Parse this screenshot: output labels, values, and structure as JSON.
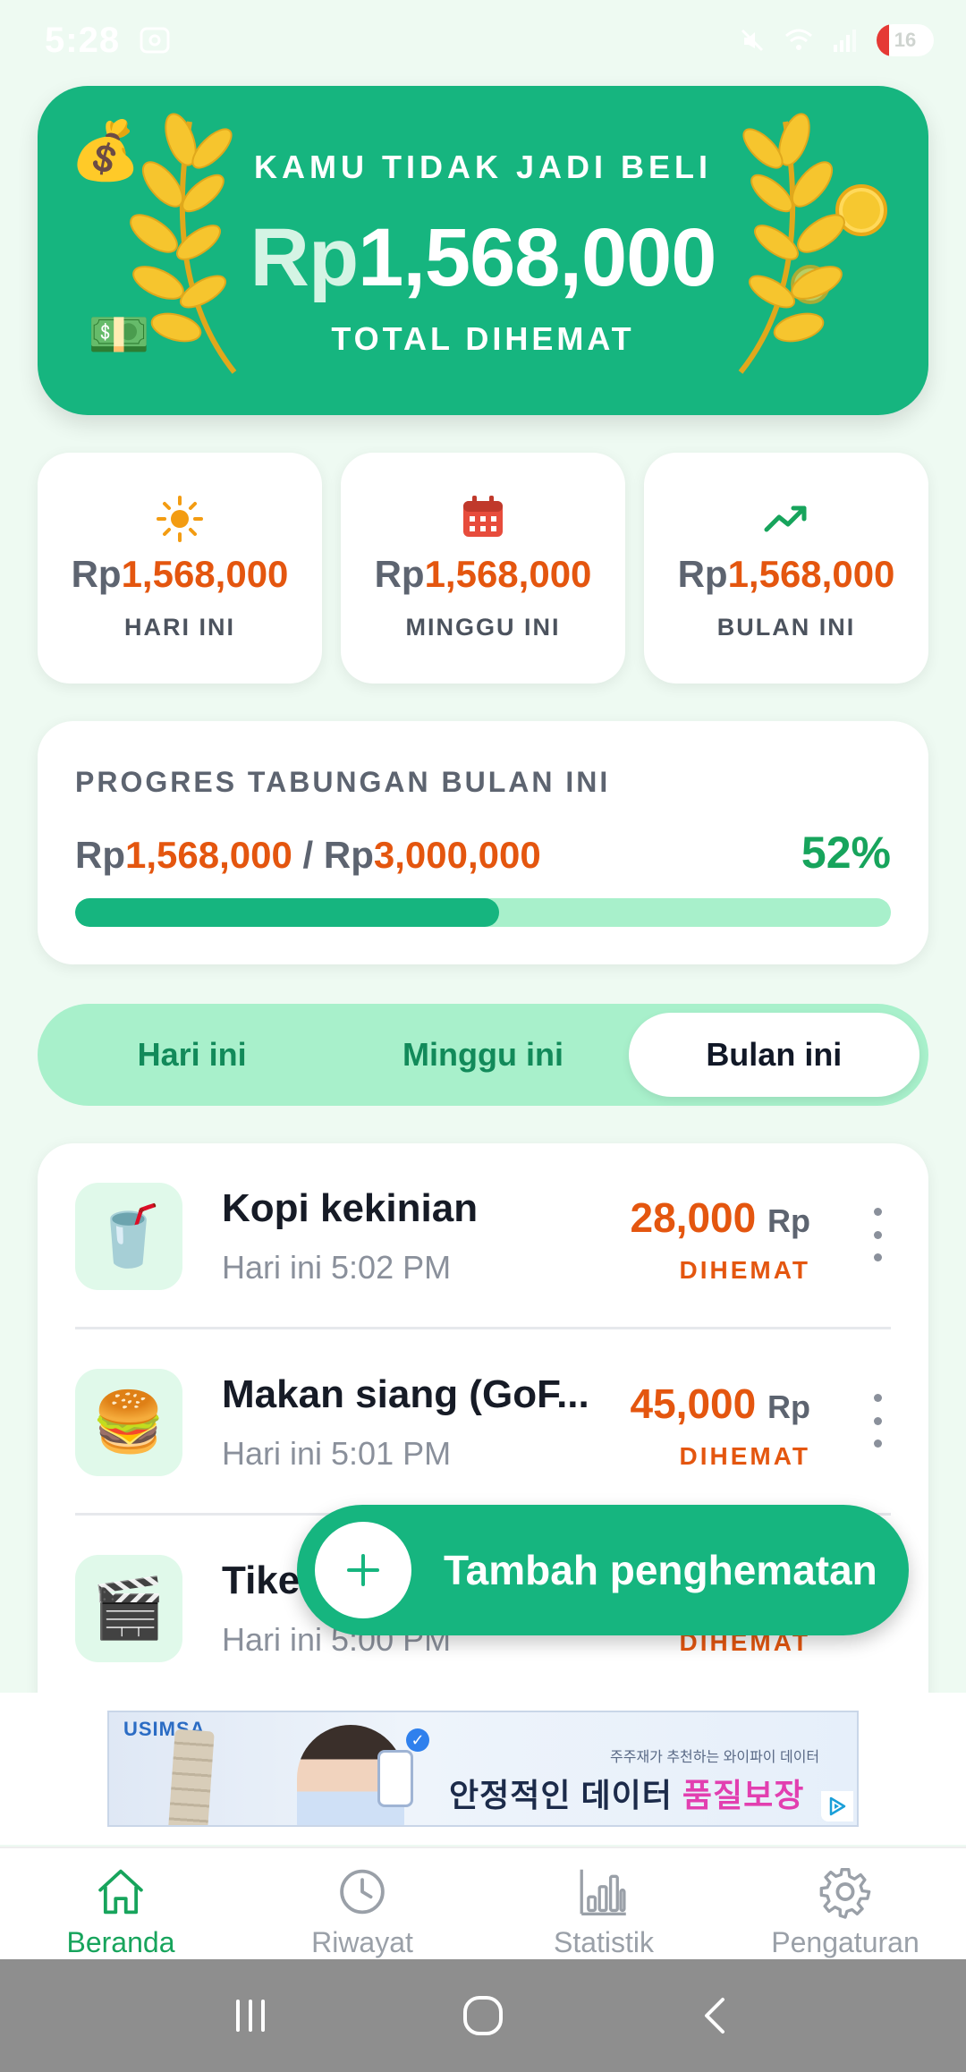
{
  "status_bar": {
    "time": "5:28",
    "battery": "16"
  },
  "hero": {
    "subtitle": "KAMU TIDAK JADI BELI",
    "currency": "Rp",
    "amount": "1,568,000",
    "caption": "TOTAL DIHEMAT",
    "icons": [
      "money-bag",
      "cash",
      "coin",
      "laurel-wreath"
    ]
  },
  "stats": [
    {
      "icon": "sun",
      "currency": "Rp",
      "value": "1,568,000",
      "label": "HARI INI"
    },
    {
      "icon": "calendar",
      "currency": "Rp",
      "value": "1,568,000",
      "label": "MINGGU INI"
    },
    {
      "icon": "trending-up",
      "currency": "Rp",
      "value": "1,568,000",
      "label": "BULAN INI"
    }
  ],
  "progress": {
    "title": "PROGRES TABUNGAN BULAN INI",
    "currency": "Rp",
    "saved": "1,568,000",
    "separator": " / ",
    "target": "3,000,000",
    "percent_label": "52%",
    "fraction": 0.52
  },
  "tabs": [
    {
      "label": "Hari ini",
      "active": false
    },
    {
      "label": "Minggu ini",
      "active": false
    },
    {
      "label": "Bulan ini",
      "active": true
    }
  ],
  "items": [
    {
      "icon": "soft-drink-cup",
      "emoji": "🥤",
      "title": "Kopi kekinian",
      "time": "Hari ini 5:02 PM",
      "amount": "28,000",
      "unit": "Rp",
      "status": "DIHEMAT"
    },
    {
      "icon": "burger",
      "emoji": "🍔",
      "title": "Makan siang (GoF...",
      "time": "Hari ini 5:01 PM",
      "amount": "45,000",
      "unit": "Rp",
      "status": "DIHEMAT"
    },
    {
      "icon": "clapperboard",
      "emoji": "🎬",
      "title": "Tike",
      "time": "Hari ini 5:00 PM",
      "amount": "",
      "unit": "",
      "status": "DIHEMAT"
    }
  ],
  "fab": {
    "label": "Tambah penghematan"
  },
  "ad": {
    "brand": "USIMSA",
    "small_text": "주주재가 추천하는 와이파이 데이터",
    "headline_plain": "안정적인 데이터 ",
    "headline_highlight": "품질보장"
  },
  "bottom_nav": [
    {
      "icon": "home",
      "label": "Beranda",
      "active": true
    },
    {
      "icon": "clock",
      "label": "Riwayat",
      "active": false
    },
    {
      "icon": "bar-chart",
      "label": "Statistik",
      "active": false
    },
    {
      "icon": "gear",
      "label": "Pengaturan",
      "active": false
    }
  ],
  "colors": {
    "primary": "#16b57f",
    "accent_orange": "#e4560f",
    "light_green": "#a8f0cb",
    "active_nav": "#17a45c"
  }
}
